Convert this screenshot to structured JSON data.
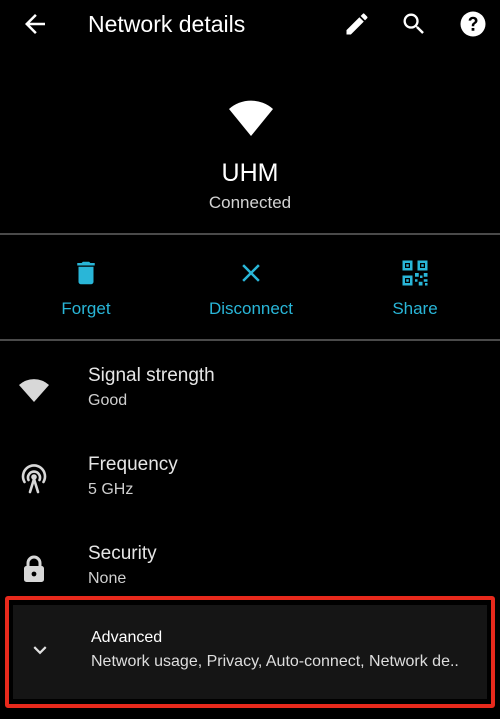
{
  "header": {
    "title": "Network details",
    "icons": [
      "arrow-back-icon",
      "edit-pencil-icon",
      "search-icon",
      "help-icon"
    ]
  },
  "network": {
    "name": "UHM",
    "status": "Connected",
    "icon": "wifi-icon"
  },
  "actions": [
    {
      "label": "Forget",
      "icon": "trash-icon"
    },
    {
      "label": "Disconnect",
      "icon": "close-icon"
    },
    {
      "label": "Share",
      "icon": "qr-code-icon"
    }
  ],
  "details": [
    {
      "title": "Signal strength",
      "value": "Good",
      "icon": "wifi-signal-icon"
    },
    {
      "title": "Frequency",
      "value": "5 GHz",
      "icon": "antenna-icon"
    },
    {
      "title": "Security",
      "value": "None",
      "icon": "lock-icon"
    }
  ],
  "advanced": {
    "title": "Advanced",
    "summary": "Network usage, Privacy, Auto-connect, Network de..",
    "icon": "chevron-down-icon"
  },
  "colors": {
    "background": "#000000",
    "accent": "#29b6d8",
    "divider": "#4a4a4a",
    "highlight_border": "#e8291c"
  }
}
